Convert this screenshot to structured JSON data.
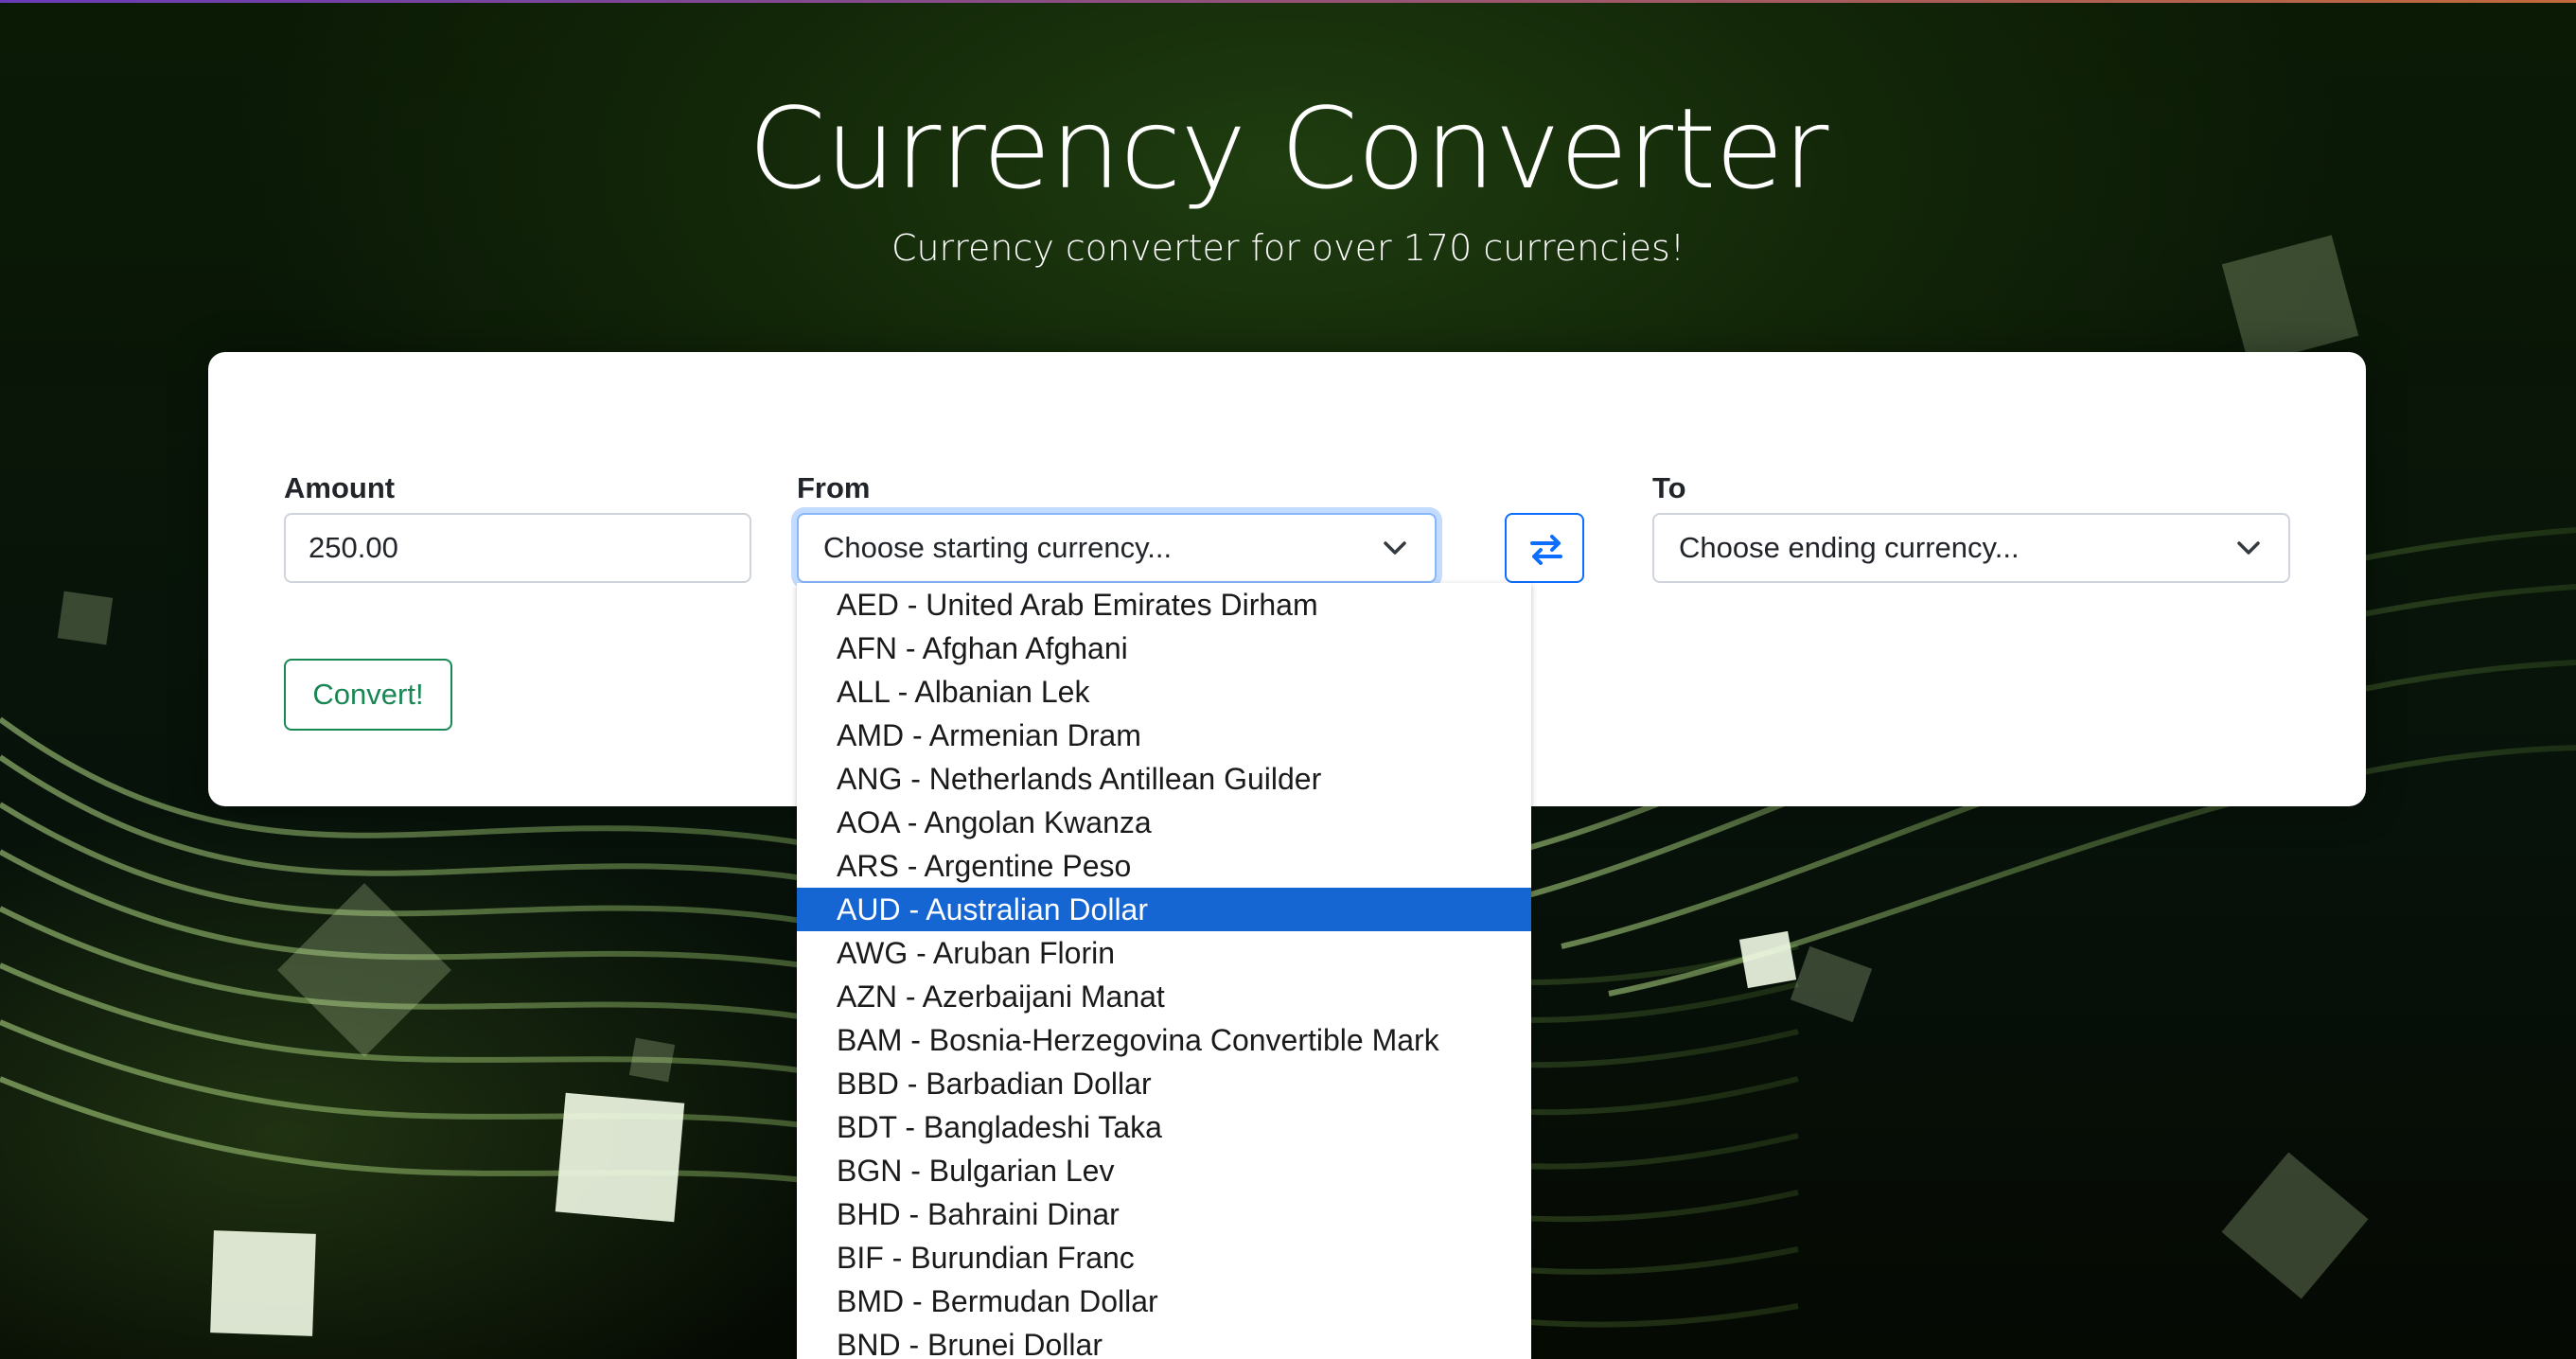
{
  "header": {
    "title": "Currency Converter",
    "subtitle": "Currency converter for over 170 currencies!"
  },
  "form": {
    "amount_label": "Amount",
    "amount_value": "250.00",
    "from_label": "From",
    "from_placeholder": "Choose starting currency...",
    "to_label": "To",
    "to_placeholder": "Choose ending currency...",
    "convert_label": "Convert!"
  },
  "icons": {
    "swap": "swap-arrows-icon",
    "chevron": "chevron-down-icon"
  },
  "colors": {
    "primary": "#0d6efd",
    "success": "#198754",
    "selected_option": "#1565d3"
  },
  "dropdown": {
    "highlighted": "AUD - Australian Dollar",
    "options": [
      "AED - United Arab Emirates Dirham",
      "AFN - Afghan Afghani",
      "ALL - Albanian Lek",
      "AMD - Armenian Dram",
      "ANG - Netherlands Antillean Guilder",
      "AOA - Angolan Kwanza",
      "ARS - Argentine Peso",
      "AUD - Australian Dollar",
      "AWG - Aruban Florin",
      "AZN - Azerbaijani Manat",
      "BAM - Bosnia-Herzegovina Convertible Mark",
      "BBD - Barbadian Dollar",
      "BDT - Bangladeshi Taka",
      "BGN - Bulgarian Lev",
      "BHD - Bahraini Dinar",
      "BIF - Burundian Franc",
      "BMD - Bermudan Dollar",
      "BND - Brunei Dollar"
    ]
  }
}
